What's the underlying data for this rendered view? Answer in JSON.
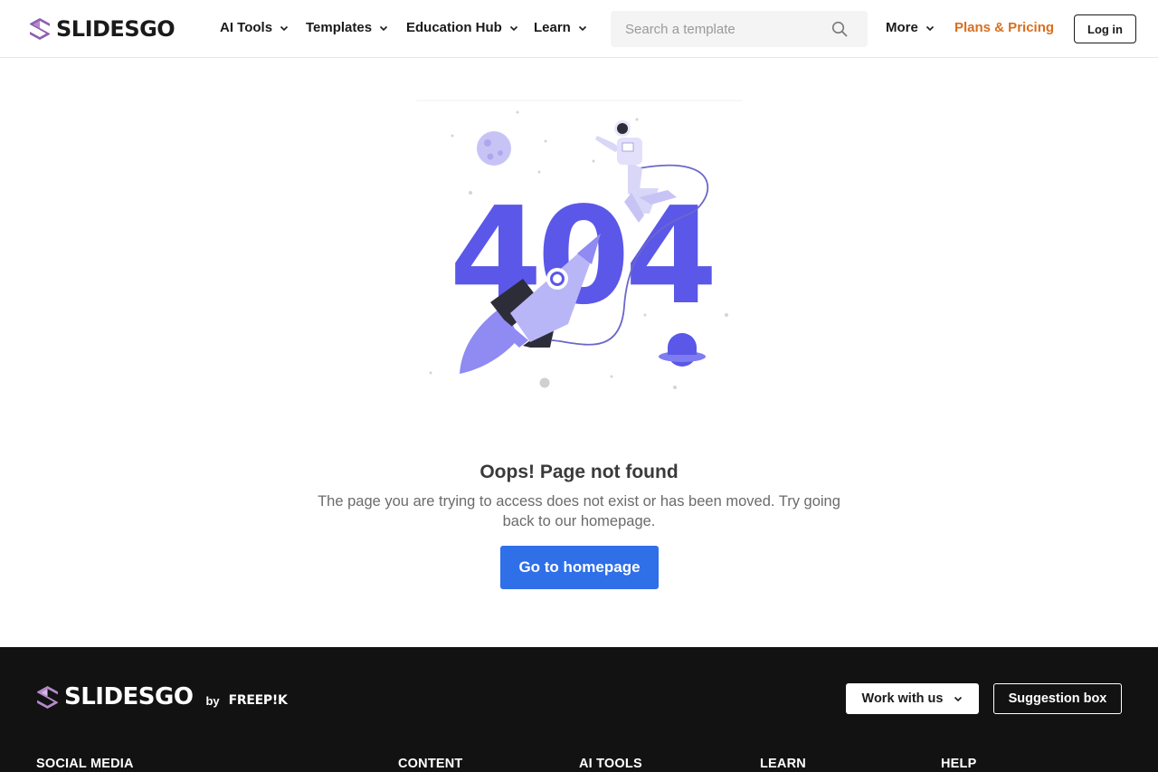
{
  "header": {
    "logo_text": "SLIDESGO",
    "nav": [
      {
        "label": "AI Tools"
      },
      {
        "label": "Templates"
      },
      {
        "label": "Education Hub"
      },
      {
        "label": "Learn"
      }
    ],
    "search_placeholder": "Search a template",
    "more_label": "More",
    "plans_label": "Plans & Pricing",
    "login_label": "Log in"
  },
  "main": {
    "illustration_text": "404",
    "title": "Oops! Page not found",
    "description": "The page you are trying to access does not exist or has been moved. Try going back to our homepage.",
    "button_label": "Go to homepage"
  },
  "footer": {
    "logo_text": "SLIDESGO",
    "by_label": "by",
    "partner_logo": "FREEP!K",
    "work_label": "Work with us",
    "suggestion_label": "Suggestion box",
    "columns": [
      "SOCIAL MEDIA",
      "CONTENT",
      "AI TOOLS",
      "LEARN",
      "HELP"
    ]
  },
  "colors": {
    "accent": "#2f6fe8",
    "plans": "#d86f1e",
    "illustration_primary": "#5b57e8",
    "illustration_light": "#c7c4f5",
    "logo_mark": "#8e5fb0",
    "footer_bg": "#121212"
  }
}
